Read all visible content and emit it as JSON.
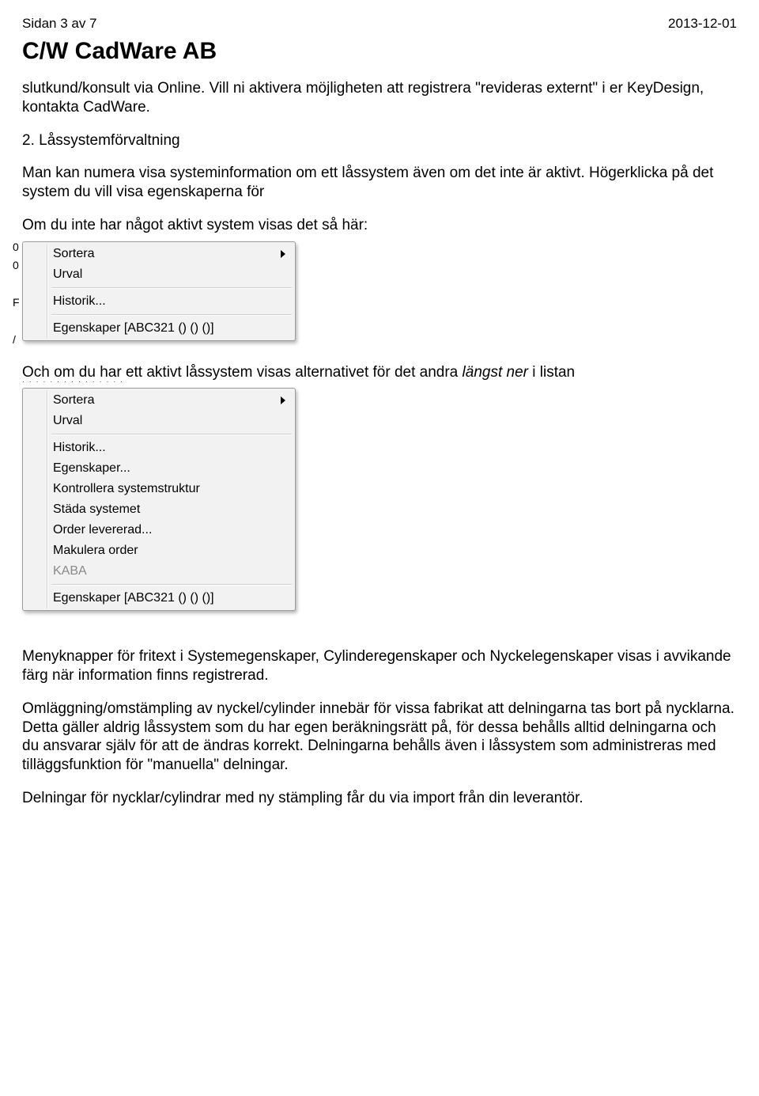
{
  "header": {
    "page_info": "Sidan 3 av 7",
    "date": "2013-12-01",
    "company": "C/W CadWare AB"
  },
  "text": {
    "p1": "slutkund/konsult via Online. Vill ni aktivera möjligheten att registrera \"revideras externt\" i er KeyDesign, kontakta CadWare.",
    "h2_num": "2. Låssystemförvaltning",
    "p2a": "Man kan numera visa systeminformation om ett låssystem även om det inte är aktivt. Högerklicka på det system du vill visa egenskaperna för",
    "p2b": "Om du inte har något aktivt system visas det så här:",
    "p3_pre": "Och om du har ett aktivt låssystem visas alternativet för det andra ",
    "p3_it": "längst ner",
    "p3_post": " i listan",
    "p4": "Menyknapper för fritext i Systemegenskaper, Cylinderegenskaper och Nyckelegenskaper visas i avvikande färg när information finns registrerad.",
    "p5": "Omläggning/omstämpling av nyckel/cylinder innebär för vissa fabrikat att delningarna tas bort på nycklarna.",
    "p6": "Detta gäller aldrig låssystem som du har egen beräkningsrätt på, för dessa behålls alltid delningarna och du ansvarar själv för att de ändras korrekt. Delningarna behålls även i låssystem som administreras med tilläggsfunktion för \"manuella\" delningar.",
    "p7": "Delningar för nycklar/cylindrar med ny stämpling får du via import från din leverantör."
  },
  "menu_short": {
    "items": [
      {
        "label": "Sortera",
        "submenu": true
      },
      {
        "label": "Urval"
      },
      {
        "sep": true
      },
      {
        "label": "Historik..."
      },
      {
        "sep": true
      },
      {
        "label": "Egenskaper [ABC321 () () ()]"
      }
    ]
  },
  "menu_long": {
    "items": [
      {
        "label": "Sortera",
        "submenu": true
      },
      {
        "label": "Urval"
      },
      {
        "sep": true
      },
      {
        "label": "Historik..."
      },
      {
        "label": "Egenskaper..."
      },
      {
        "label": "Kontrollera systemstruktur"
      },
      {
        "label": "Städa systemet"
      },
      {
        "label": "Order levererad..."
      },
      {
        "label": "Makulera order"
      },
      {
        "label": "KABA",
        "disabled": true
      },
      {
        "sep": true
      },
      {
        "label": "Egenskaper [ABC321 () () ()]"
      }
    ]
  }
}
